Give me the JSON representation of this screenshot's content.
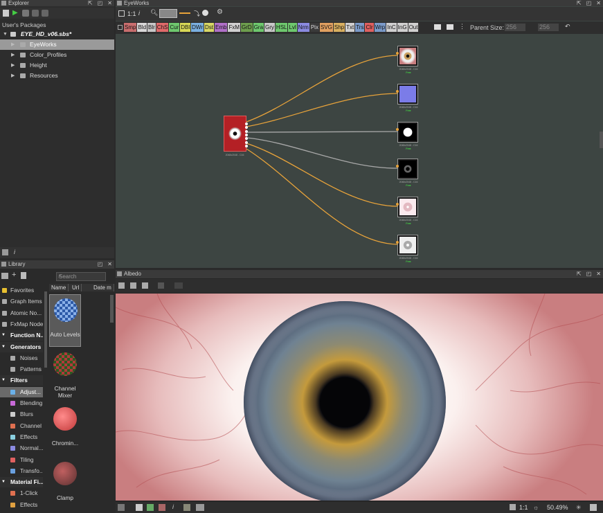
{
  "explorer": {
    "title": "Explorer",
    "section": "User's Packages",
    "package": "EYE_HD_v06.sbs*",
    "items": [
      {
        "label": "EyeWorks",
        "selected": true
      },
      {
        "label": "Color_Profiles"
      },
      {
        "label": "Height"
      },
      {
        "label": "Resources"
      }
    ],
    "footer_info": "i"
  },
  "graph": {
    "title": "EyeWorks",
    "zoom_label": "1:1",
    "info_label": "i",
    "parent_size_label": "Parent Size:",
    "parent_size_value": "256",
    "size_value": "256",
    "atomic_chips": [
      {
        "label": "Smp",
        "color": "#c96e6e"
      },
      {
        "label": "Bld",
        "color": "#d8d8d8"
      },
      {
        "label": "Blr",
        "color": "#c8c8c8"
      },
      {
        "label": "ChS",
        "color": "#e06a6a"
      },
      {
        "label": "Cur",
        "color": "#6ec86e"
      },
      {
        "label": "DBl",
        "color": "#d8d856"
      },
      {
        "label": "DWr",
        "color": "#7ab0e0"
      },
      {
        "label": "Dst",
        "color": "#d8d866"
      },
      {
        "label": "Emb",
        "color": "#b070c8"
      },
      {
        "label": "FxM",
        "color": "#d0d0d0"
      },
      {
        "label": "GrD",
        "color": "#6e9e4e"
      },
      {
        "label": "Gra",
        "color": "#6ec86e"
      },
      {
        "label": "Gry",
        "color": "#c8c8c8"
      },
      {
        "label": "HSL",
        "color": "#6ec86e"
      },
      {
        "label": "Lvl",
        "color": "#6ec86e"
      },
      {
        "label": "Nrm",
        "color": "#8a8ae0"
      },
      {
        "label": "Pix",
        "color": "#3a3a3a"
      },
      {
        "label": "SVG",
        "color": "#e0a060"
      },
      {
        "label": "Shp",
        "color": "#d8b060"
      },
      {
        "label": "Txt",
        "color": "#d0d0d0"
      },
      {
        "label": "Trs",
        "color": "#7a9ac8"
      },
      {
        "label": "Clr",
        "color": "#e06060"
      },
      {
        "label": "Wrp",
        "color": "#7a9ac8"
      },
      {
        "label": "InC",
        "color": "#d0d0d0"
      },
      {
        "label": "InG",
        "color": "#d0d0d0"
      },
      {
        "label": "Out",
        "color": "#d0d0d0"
      }
    ],
    "nodes": [
      {
        "name": "source-node",
        "label": "2048x2048 - C16",
        "status": "",
        "kind": "red"
      },
      {
        "name": "output-node-1",
        "label": "2048x2048 - C16",
        "status": "Free",
        "kind": "eye"
      },
      {
        "name": "output-node-2",
        "label": "2048x2048 - C16",
        "status": "Free",
        "kind": "purple"
      },
      {
        "name": "output-node-3",
        "label": "2048x2048 - C16",
        "status": "Free",
        "kind": "white-disc"
      },
      {
        "name": "output-node-4",
        "label": "2048x2048 - C16",
        "status": "Free",
        "kind": "dark-ring"
      },
      {
        "name": "output-node-5",
        "label": "2048x2048 - C16",
        "status": "Free",
        "kind": "pink-iris"
      },
      {
        "name": "output-node-6",
        "label": "2048x2048 - C16",
        "status": "Free",
        "kind": "gray-iris"
      }
    ],
    "accent": "#e8a33a"
  },
  "library": {
    "title": "Library",
    "search_placeholder": "Search",
    "columns": [
      "Name",
      "Url",
      "Date m"
    ],
    "categories": [
      {
        "label": "Favorites",
        "type": "item",
        "icon_color": "#e8c030"
      },
      {
        "label": "Graph Items",
        "type": "item",
        "icon_color": "#aaaaaa"
      },
      {
        "label": "Atomic No...",
        "type": "item",
        "icon_color": "#aaaaaa"
      },
      {
        "label": "FxMap Node",
        "type": "item",
        "icon_color": "#aaaaaa"
      },
      {
        "label": "Function N...",
        "type": "head",
        "icon_color": "#cccccc"
      },
      {
        "label": "Generators",
        "type": "head",
        "icon_color": "#cccccc"
      },
      {
        "label": "Noises",
        "type": "sub",
        "icon_color": "#aaaaaa"
      },
      {
        "label": "Patterns",
        "type": "sub",
        "icon_color": "#aaaaaa"
      },
      {
        "label": "Filters",
        "type": "head",
        "icon_color": "#cccccc"
      },
      {
        "label": "Adjust...",
        "type": "sub",
        "icon_color": "#6ab0e8",
        "selected": true
      },
      {
        "label": "Blending",
        "type": "sub",
        "icon_color": "#c86ad8"
      },
      {
        "label": "Blurs",
        "type": "sub",
        "icon_color": "#cccccc"
      },
      {
        "label": "Channel",
        "type": "sub",
        "icon_color": "#e07050"
      },
      {
        "label": "Effects",
        "type": "sub",
        "icon_color": "#8ad0e0"
      },
      {
        "label": "Normal...",
        "type": "sub",
        "icon_color": "#8a8ae0"
      },
      {
        "label": "Tiling",
        "type": "sub",
        "icon_color": "#e06060"
      },
      {
        "label": "Transfo...",
        "type": "sub",
        "icon_color": "#6aa0e0"
      },
      {
        "label": "Material Fi...",
        "type": "head",
        "icon_color": "#cccccc"
      },
      {
        "label": "1-Click",
        "type": "sub",
        "icon_color": "#e07050"
      },
      {
        "label": "Effects",
        "type": "sub",
        "icon_color": "#e0a040"
      }
    ],
    "tiles": [
      {
        "label": "Auto Levels",
        "swatch": "checker-blue",
        "selected": true
      },
      {
        "label": "Channel Mixer",
        "swatch": "checker-green"
      },
      {
        "label": "Chromin...",
        "swatch": "red-gradient"
      },
      {
        "label": "Clamp",
        "swatch": "dark-red-gradient"
      }
    ]
  },
  "viewer": {
    "title": "Albedo",
    "zoom_ratio": "1:1",
    "zoom_percent": "50.49%"
  },
  "colors": {
    "panel_bg": "#2d2d2d",
    "graph_bg": "#3d4542",
    "titlebar": "#3a3a3a",
    "accent": "#e8a33a"
  }
}
